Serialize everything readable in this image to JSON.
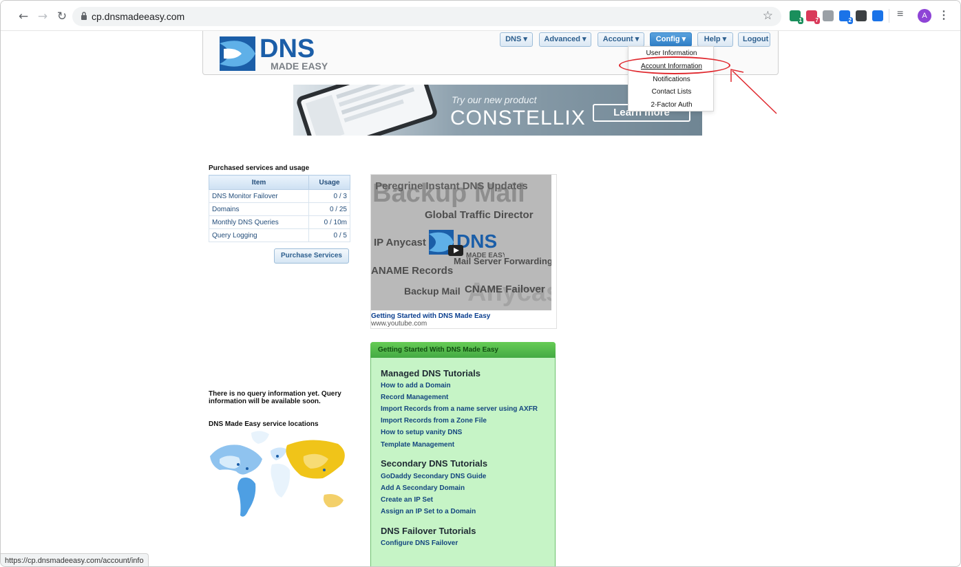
{
  "browser": {
    "url": "cp.dnsmadeeasy.com",
    "status_url": "https://cp.dnsmadeeasy.com/account/info",
    "profile_initial": "A",
    "extensions": [
      {
        "name": "eyedropper-extension",
        "badge": "1",
        "color": "#1a8f5c"
      },
      {
        "name": "mailtrack-extension",
        "badge": "7",
        "color": "#d93a5a"
      },
      {
        "name": "grey-extension",
        "badge": "",
        "color": "#9aa0a6"
      },
      {
        "name": "puzzle-extension",
        "badge": "2",
        "color": "#1a73e8"
      },
      {
        "name": "dark-extension",
        "badge": "",
        "color": "#3c4043"
      },
      {
        "name": "download-extension",
        "badge": "",
        "color": "#1a73e8"
      }
    ]
  },
  "logo": {
    "text": "DNS",
    "subtext": "MADE EASY"
  },
  "menu": {
    "dns": "DNS",
    "advanced": "Advanced",
    "account": "Account",
    "config": "Config",
    "help": "Help",
    "logout": "Logout"
  },
  "config_menu": {
    "items": [
      "User Information",
      "Account Information",
      "Notifications",
      "Contact Lists",
      "2-Factor Auth"
    ]
  },
  "banner": {
    "try_text": "Try our new product",
    "brand": "CONSTELLIX",
    "cta": "Learn more"
  },
  "purchased": {
    "title": "Purchased services and usage",
    "headers": [
      "Item",
      "Usage"
    ],
    "rows": [
      {
        "item": "DNS Monitor Failover",
        "usage": "0 / 3"
      },
      {
        "item": "Domains",
        "usage": "0 / 25"
      },
      {
        "item": "Monthly DNS Queries",
        "usage": "0 / 10m"
      },
      {
        "item": "Query Logging",
        "usage": "0 / 5"
      }
    ],
    "button": "Purchase Services"
  },
  "video": {
    "title": "Getting Started with DNS Made Easy",
    "source": "www.youtube.com",
    "thumb_texts": [
      "Peregrine Instant DNS Updates",
      "Backup Mail",
      "Global Traffic Director",
      "IP Anycast",
      "Mail Server Forwarding",
      "ANAME Records",
      "Backup Mail",
      "CNAME Failover",
      "Anycast",
      "DNS",
      "MADE EASY"
    ]
  },
  "getting_started": {
    "header": "Getting Started With DNS Made Easy",
    "sections": [
      {
        "title": "Managed DNS Tutorials",
        "links": [
          "How to add a Domain",
          "Record Management",
          "Import Records from a name server using AXFR",
          "Import Records from a Zone File",
          "How to setup vanity DNS",
          "Template Management"
        ]
      },
      {
        "title": "Secondary DNS Tutorials",
        "links": [
          "GoDaddy Secondary DNS Guide",
          "Add A Secondary Domain",
          "Create an IP Set",
          "Assign an IP Set to a Domain"
        ]
      },
      {
        "title": "DNS Failover Tutorials",
        "links": [
          "Configure DNS Failover"
        ]
      }
    ]
  },
  "query_info": "There is no query information yet. Query information will be available soon.",
  "locations_title": "DNS Made Easy service locations"
}
